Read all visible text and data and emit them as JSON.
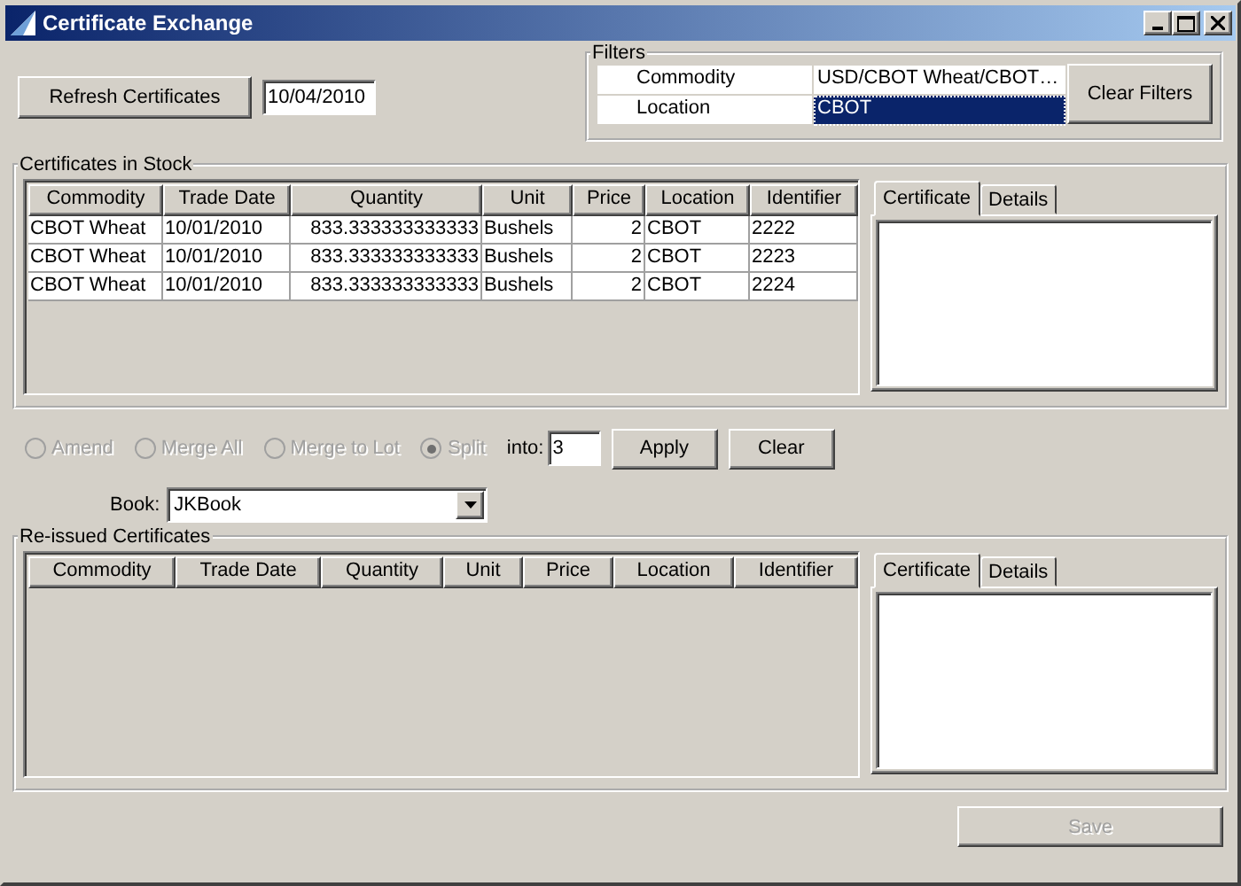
{
  "window": {
    "title": "Certificate Exchange"
  },
  "toolbar": {
    "refresh_button": "Refresh Certificates",
    "date": "10/04/2010"
  },
  "filters": {
    "title": "Filters",
    "rows": [
      {
        "label": "Commodity",
        "value": "USD/CBOT Wheat/CBOT…",
        "selected": false
      },
      {
        "label": "Location",
        "value": "CBOT",
        "selected": true
      }
    ],
    "clear_button": "Clear Filters"
  },
  "stock": {
    "title": "Certificates in Stock",
    "columns": [
      {
        "label": "Commodity",
        "numeric": false
      },
      {
        "label": "Trade Date",
        "numeric": false
      },
      {
        "label": "Quantity",
        "numeric": true
      },
      {
        "label": "Unit",
        "numeric": false
      },
      {
        "label": "Price",
        "numeric": true
      },
      {
        "label": "Location",
        "numeric": false
      },
      {
        "label": "Identifier",
        "numeric": false
      }
    ],
    "rows": [
      [
        "CBOT Wheat",
        "10/01/2010",
        "833.333333333333",
        "Bushels",
        "2",
        "CBOT",
        "2222"
      ],
      [
        "CBOT Wheat",
        "10/01/2010",
        "833.333333333333",
        "Bushels",
        "2",
        "CBOT",
        "2223"
      ],
      [
        "CBOT Wheat",
        "10/01/2010",
        "833.333333333333",
        "Bushels",
        "2",
        "CBOT",
        "2224"
      ]
    ],
    "tabs": [
      {
        "label": "Certificate",
        "selected": true
      },
      {
        "label": "Details",
        "selected": false
      }
    ]
  },
  "actions": {
    "options": [
      {
        "label": "Amend",
        "checked": false,
        "disabled": true
      },
      {
        "label": "Merge All",
        "checked": false,
        "disabled": true
      },
      {
        "label": "Merge to Lot",
        "checked": false,
        "disabled": true
      },
      {
        "label": "Split",
        "checked": true,
        "disabled": true
      }
    ],
    "into_label": "into:",
    "into_value": "3",
    "apply_button": "Apply",
    "clear_button": "Clear"
  },
  "book": {
    "label": "Book:",
    "value": "JKBook"
  },
  "reissued": {
    "title": "Re-issued Certificates",
    "columns": [
      {
        "label": "Commodity"
      },
      {
        "label": "Trade Date"
      },
      {
        "label": "Quantity"
      },
      {
        "label": "Unit"
      },
      {
        "label": "Price"
      },
      {
        "label": "Location"
      },
      {
        "label": "Identifier"
      }
    ],
    "tabs": [
      {
        "label": "Certificate",
        "selected": true
      },
      {
        "label": "Details",
        "selected": false
      }
    ]
  },
  "save_button": {
    "label": "Save",
    "disabled": true
  }
}
